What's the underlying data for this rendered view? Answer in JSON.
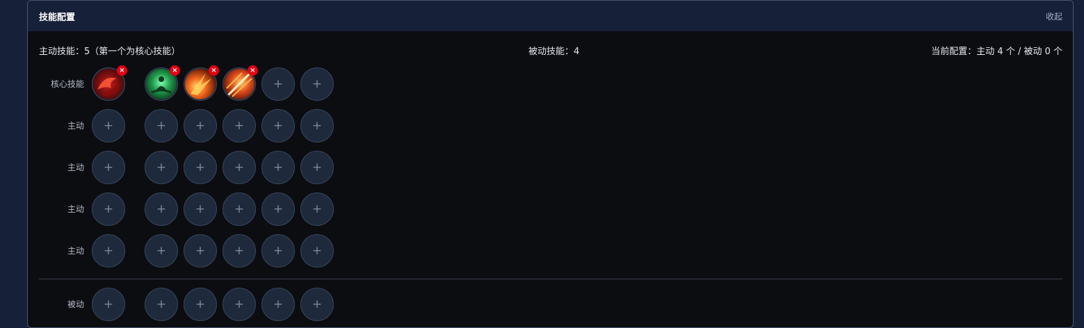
{
  "panel": {
    "title": "技能配置",
    "collapse_label": "收起"
  },
  "summary": {
    "active_text": "主动技能：5（第一个为核心技能）",
    "passive_text": "被动技能：4",
    "current_text": "当前配置：主动 4 个 / 被动 0 个"
  },
  "rows": [
    {
      "label": "核心技能"
    },
    {
      "label": "主动"
    },
    {
      "label": "主动"
    },
    {
      "label": "主动"
    },
    {
      "label": "主动"
    },
    {
      "label": "被动"
    }
  ],
  "slot_symbols": {
    "empty": "+",
    "remove": "×"
  },
  "equipped_icons": [
    "red-dragon-skill-icon",
    "green-meditation-skill-icon",
    "fire-burst-skill-icon",
    "fire-slash-skill-icon"
  ],
  "colors": {
    "header_bg": "#172039",
    "panel_bg": "#0c0d11",
    "remove_badge": "#e60012",
    "slot_bg": "#1e2a3c"
  }
}
